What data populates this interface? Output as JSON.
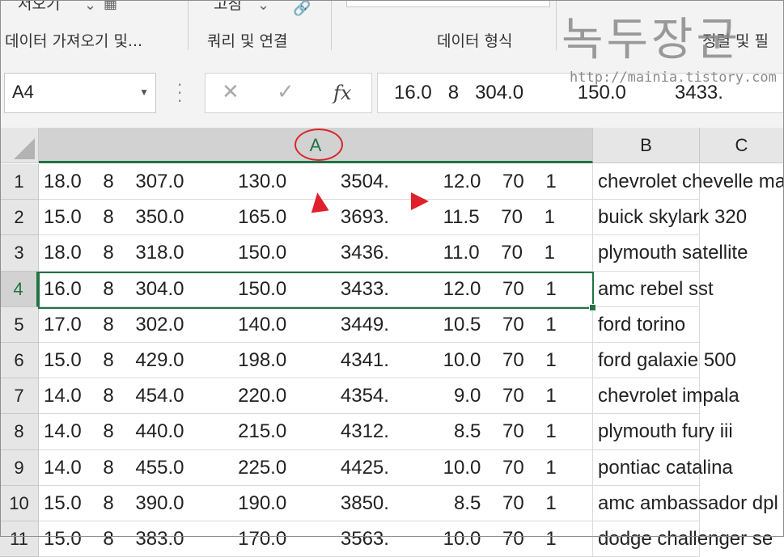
{
  "ribbon": {
    "top_labels": [
      "저오기",
      "고침"
    ],
    "group_labels": [
      "데이터 가져오기 및...",
      "쿼리 및 연결",
      "데이터 형식",
      "정렬 및 필"
    ]
  },
  "watermark": {
    "title": "녹두장군",
    "url": "http://mainia.tistory.com"
  },
  "formula_bar": {
    "name_box": "A4",
    "cancel_icon": "✕",
    "enter_icon": "✓",
    "fx_label": "fx",
    "formula": "16.0   8   304.0          150.0         3433."
  },
  "columns": [
    "A",
    "B",
    "C"
  ],
  "selected_column": "A",
  "selected_row": "4",
  "rows": [
    {
      "num": "1",
      "a": "18.0    8    307.0          130.0          3504.          12.0    70    1",
      "b": "chevrolet chevelle malibu"
    },
    {
      "num": "2",
      "a": "15.0    8    350.0          165.0          3693.          11.5    70    1",
      "b": "buick skylark 320"
    },
    {
      "num": "3",
      "a": "18.0    8    318.0          150.0          3436.          11.0    70    1",
      "b": "plymouth satellite"
    },
    {
      "num": "4",
      "a": "16.0    8    304.0          150.0          3433.          12.0    70    1",
      "b": "amc rebel sst"
    },
    {
      "num": "5",
      "a": "17.0    8    302.0          140.0          3449.          10.5    70    1",
      "b": "ford torino"
    },
    {
      "num": "6",
      "a": "15.0    8    429.0          198.0          4341.          10.0    70    1",
      "b": "ford galaxie 500"
    },
    {
      "num": "7",
      "a": "14.0    8    454.0          220.0          4354.            9.0    70    1",
      "b": "chevrolet impala"
    },
    {
      "num": "8",
      "a": "14.0    8    440.0          215.0          4312.            8.5    70    1",
      "b": "plymouth fury iii"
    },
    {
      "num": "9",
      "a": "14.0    8    455.0          225.0          4425.          10.0    70    1",
      "b": "pontiac catalina"
    },
    {
      "num": "10",
      "a": "15.0    8    390.0          190.0          3850.            8.5    70    1",
      "b": "amc ambassador dpl"
    },
    {
      "num": "11",
      "a": "15.0    8    383.0          170.0          3563.          10.0    70    1",
      "b": "dodge challenger se"
    }
  ],
  "colors": {
    "excel_green": "#217346",
    "annotation_red": "#e0202a"
  }
}
